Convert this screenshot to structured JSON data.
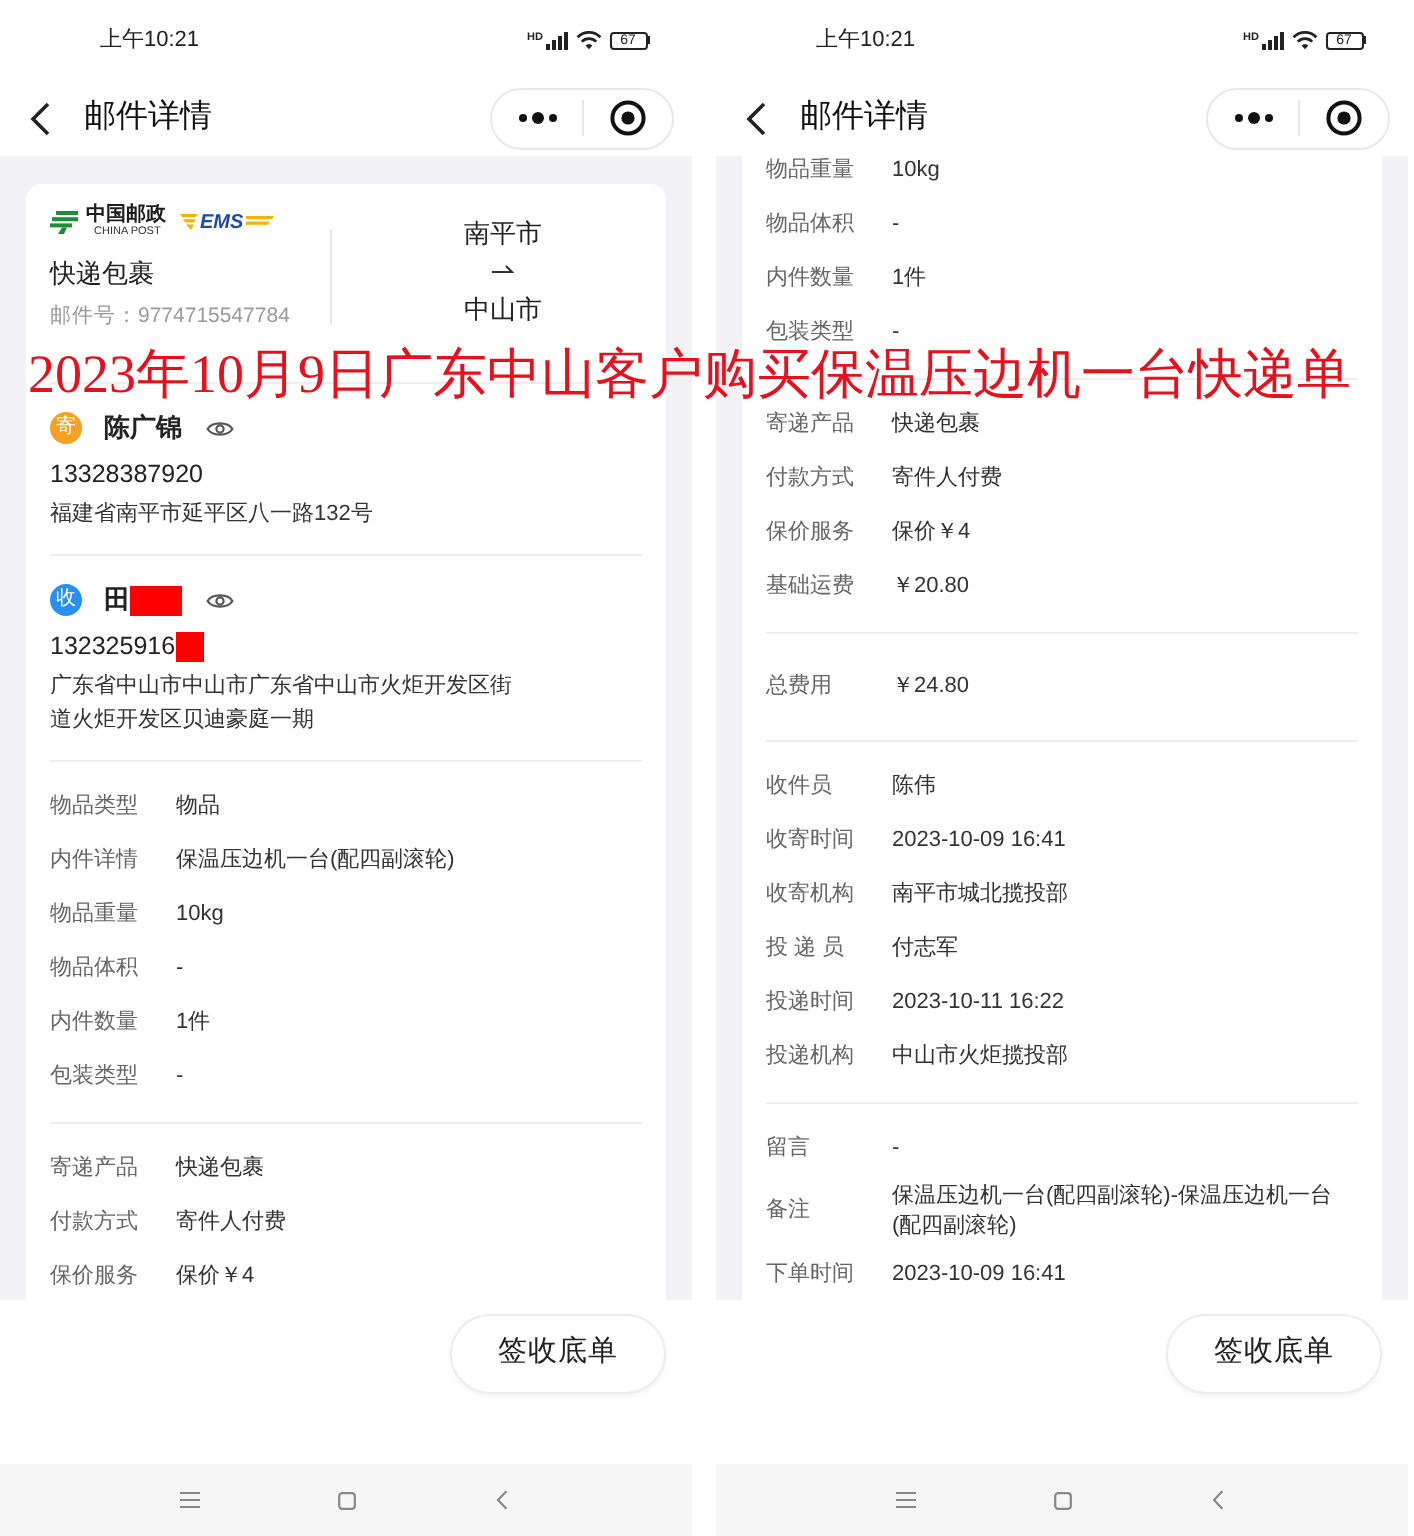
{
  "caption": "2023年10月9日广东中山客户购买保温压边机一台快递单",
  "screens": [
    {
      "status_bar": {
        "time": "上午10:21",
        "network": "HD",
        "battery": "67"
      },
      "header": {
        "title": "邮件详情"
      },
      "card": {
        "summary": {
          "logos": [
            {
              "kind": "china_post",
              "name": "中国邮政",
              "subtitle": "CHINA POST"
            },
            {
              "kind": "ems",
              "name": "EMS"
            }
          ],
          "product": "快递包裹",
          "tracking_number": "邮件号：9774715547784",
          "origin": "南平市",
          "destination": "中山市"
        },
        "parties": [
          {
            "badge": "寄",
            "color": "#f5a020",
            "name": "陈广锦",
            "name_redacted": false,
            "phone": "13328387920",
            "phone_redacted": false,
            "address": "福建省南平市延平区八一路132号"
          },
          {
            "badge": "收",
            "color": "#2b8ff0",
            "name": "田",
            "name_redacted": true,
            "phone": "132325916",
            "phone_redacted": true,
            "address": "广东省中山市中山市广东省中山市火炬开发区街道火炬开发区贝迪豪庭一期"
          }
        ],
        "groups": [
          [
            {
              "label": "物品类型",
              "value": "物品"
            },
            {
              "label": "内件详情",
              "value": "保温压边机一台(配四副滚轮)"
            },
            {
              "label": "物品重量",
              "value": "10kg"
            },
            {
              "label": "物品体积",
              "value": "-"
            },
            {
              "label": "内件数量",
              "value": "1件"
            },
            {
              "label": "包装类型",
              "value": "-"
            }
          ],
          [
            {
              "label": "寄递产品",
              "value": "快递包裹"
            },
            {
              "label": "付款方式",
              "value": "寄件人付费"
            },
            {
              "label": "保价服务",
              "value": "保价￥4"
            }
          ]
        ]
      },
      "footer_button": "签收底单"
    },
    {
      "status_bar": {
        "time": "上午10:21",
        "network": "HD",
        "battery": "67"
      },
      "header": {
        "title": "邮件详情"
      },
      "card": {
        "groups": [
          [
            {
              "label": "物品重量",
              "value": "10kg"
            },
            {
              "label": "物品体积",
              "value": "-"
            },
            {
              "label": "内件数量",
              "value": "1件"
            },
            {
              "label": "包装类型",
              "value": "-"
            }
          ],
          [
            {
              "label": "寄递产品",
              "value": "快递包裹"
            },
            {
              "label": "付款方式",
              "value": "寄件人付费"
            },
            {
              "label": "保价服务",
              "value": "保价￥4"
            },
            {
              "label": "基础运费",
              "value": "￥20.80"
            }
          ],
          [
            {
              "label": "总费用",
              "value": "￥24.80"
            }
          ],
          [
            {
              "label": "收件员",
              "value": "陈伟"
            },
            {
              "label": "收寄时间",
              "value": "2023-10-09 16:41"
            },
            {
              "label": "收寄机构",
              "value": "南平市城北揽投部"
            },
            {
              "label": "投 递 员",
              "value": "付志军"
            },
            {
              "label": "投递时间",
              "value": "2023-10-11 16:22"
            },
            {
              "label": "投递机构",
              "value": "中山市火炬揽投部"
            }
          ],
          [
            {
              "label": "留言",
              "value": "-"
            },
            {
              "label": "备注",
              "value": "保温压边机一台(配四副滚轮)-保温压边机一台(配四副滚轮)"
            },
            {
              "label": "下单时间",
              "value": "2023-10-09 16:41"
            }
          ]
        ]
      },
      "footer_button": "签收底单"
    }
  ]
}
